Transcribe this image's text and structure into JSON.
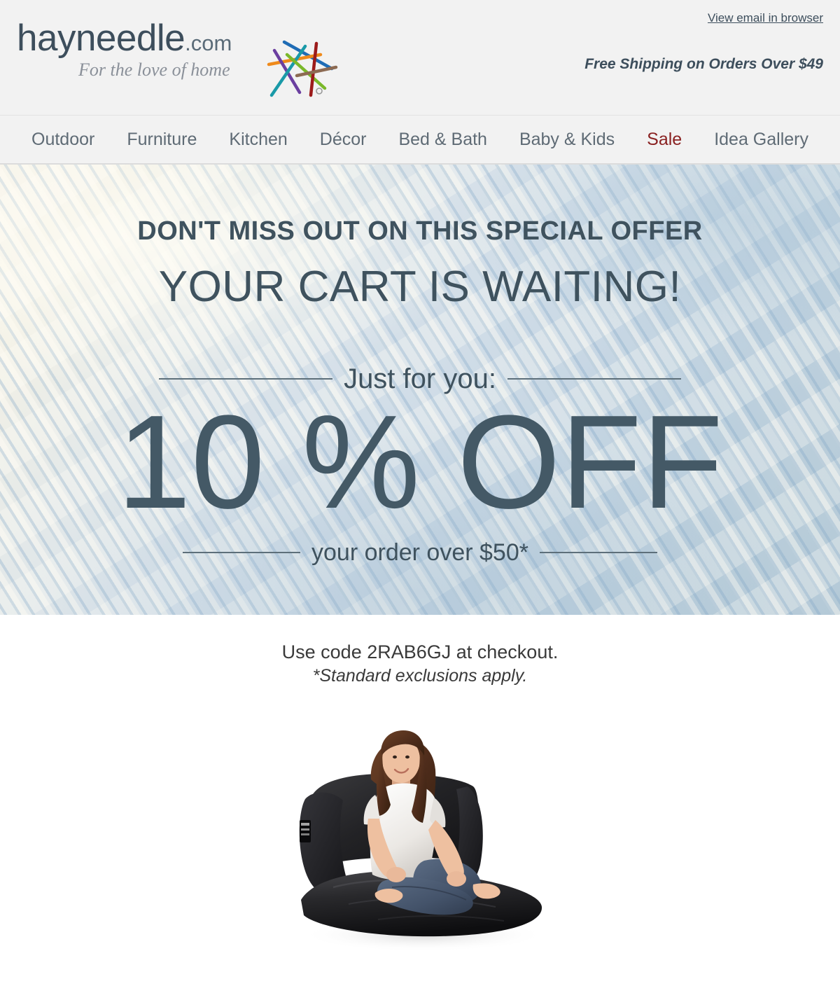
{
  "header": {
    "logo": {
      "wordmark": "hayneedle",
      "dotcom": ".com",
      "tagline": "For the love of home",
      "mark_icon": "crossed-needles-logo-icon"
    },
    "view_in_browser_label": "View email in browser",
    "free_shipping_label": "Free Shipping on Orders Over $49",
    "bg_color": "#f2f2f2",
    "text_color": "#3d4e5c"
  },
  "nav": {
    "items": [
      {
        "label": "Outdoor",
        "name": "nav-item-outdoor",
        "highlight": false
      },
      {
        "label": "Furniture",
        "name": "nav-item-furniture",
        "highlight": false
      },
      {
        "label": "Kitchen",
        "name": "nav-item-kitchen",
        "highlight": false
      },
      {
        "label": "Décor",
        "name": "nav-item-decor",
        "highlight": false
      },
      {
        "label": "Bed & Bath",
        "name": "nav-item-bed-and-bath",
        "highlight": false
      },
      {
        "label": "Baby & Kids",
        "name": "nav-item-baby-and-kids",
        "highlight": false
      },
      {
        "label": "Sale",
        "name": "nav-item-sale",
        "highlight": true
      },
      {
        "label": "Idea Gallery",
        "name": "nav-item-idea-gallery",
        "highlight": false
      }
    ],
    "link_color": "#5f6b75",
    "sale_color": "#8a2222"
  },
  "hero": {
    "kicker": "DON'T MISS OUT ON THIS SPECIAL OFFER",
    "headline": "YOUR CART IS WAITING!",
    "just_for_you": "Just for you:",
    "percent_off": "10 % OFF",
    "order_over": "your order over $50*",
    "text_color": "#3f525e",
    "bg_description": "blue-and-cream woven fabric texture with diagonal stitching"
  },
  "promo": {
    "code_line": "Use code 2RAB6GJ at checkout.",
    "code": "2RAB6GJ",
    "fine_print": "*Standard exclusions apply."
  },
  "product": {
    "image_alt": "woman sitting on a black bean bag lounge chair",
    "chair_color": "#1d1d1f",
    "shirt_color": "#f6f4f1",
    "jeans_color": "#49586e",
    "hair_color": "#5a3323",
    "skin_color": "#e8bc9d"
  }
}
